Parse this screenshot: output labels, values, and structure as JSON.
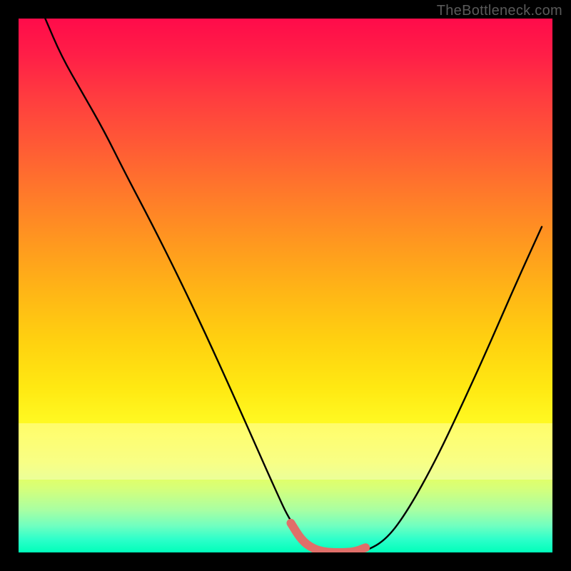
{
  "watermark": {
    "text": "TheBottleneck.com"
  },
  "chart_data": {
    "type": "line",
    "title": "",
    "xlabel": "",
    "ylabel": "",
    "xlim": [
      0,
      100
    ],
    "ylim": [
      0,
      100
    ],
    "series": [
      {
        "name": "black-curve",
        "color": "#000000",
        "x": [
          5,
          8,
          12,
          16,
          20,
          25,
          30,
          35,
          40,
          44,
          48,
          51,
          55,
          57,
          60,
          62,
          65,
          69,
          73,
          78,
          83,
          88,
          93,
          98
        ],
        "y": [
          100,
          93,
          86,
          79,
          71,
          61.5,
          51.5,
          41,
          30,
          21,
          12,
          5.5,
          1,
          0.1,
          0,
          0,
          0.2,
          2.5,
          8,
          17,
          27.5,
          38.5,
          50,
          61
        ]
      },
      {
        "name": "valley-marker",
        "color": "#e06f69",
        "x": [
          51,
          53,
          55,
          57,
          59,
          61,
          63,
          65
        ],
        "y": [
          5.5,
          2.3,
          0.8,
          0.15,
          0,
          0,
          0.15,
          0.9
        ]
      }
    ],
    "bands": [
      {
        "name": "pale-band",
        "y_from": 13.6,
        "y_to": 24.2
      }
    ]
  }
}
